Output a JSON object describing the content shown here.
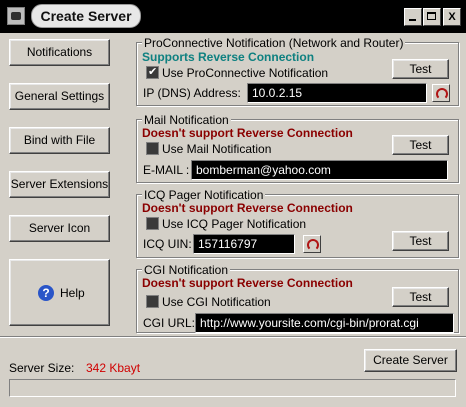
{
  "window": {
    "title": "Create Server",
    "icon": "app-icon",
    "minimize_icon": "minimize-icon",
    "maximize_icon": "maximize-icon",
    "close_glyph": "X"
  },
  "sidebar": {
    "items": [
      {
        "label": "Notifications"
      },
      {
        "label": "General Settings"
      },
      {
        "label": "Bind with File"
      },
      {
        "label": "Server Extensions"
      },
      {
        "label": "Server Icon"
      }
    ],
    "help": {
      "label": "Help",
      "icon_glyph": "?"
    }
  },
  "proconnective": {
    "legend": "ProConnective Notification (Network and Router)",
    "status": "Supports Reverse Connection",
    "checkbox_label": "Use ProConnective Notification",
    "checked": true,
    "test_label": "Test",
    "field_label": "IP (DNS) Address:",
    "field_value": "10.0.2.15"
  },
  "mail": {
    "legend": "Mail Notification",
    "status": "Doesn't support Reverse Connection",
    "checkbox_label": "Use Mail Notification",
    "checked": false,
    "test_label": "Test",
    "field_label": "E-MAIL :",
    "field_value": "bomberman@yahoo.com"
  },
  "icq": {
    "legend": "ICQ Pager Notification",
    "status": "Doesn't support Reverse Connection",
    "checkbox_label": "Use ICQ Pager Notification",
    "checked": false,
    "test_label": "Test",
    "field_label": "ICQ UIN:",
    "field_value": "157116797"
  },
  "cgi": {
    "legend": "CGI Notification",
    "status": "Doesn't support Reverse Connection",
    "checkbox_label": "Use CGI Notification",
    "checked": false,
    "test_label": "Test",
    "field_label": "CGI URL:",
    "field_value": "http://www.yoursite.com/cgi-bin/prorat.cgi"
  },
  "footer": {
    "size_label": "Server Size:",
    "size_value": "342 Kbayt",
    "create_label": "Create Server",
    "progress_fraction": 0
  },
  "colors": {
    "supports": "#0e8080",
    "not_supports": "#8a0000",
    "size_value": "#d00000"
  }
}
